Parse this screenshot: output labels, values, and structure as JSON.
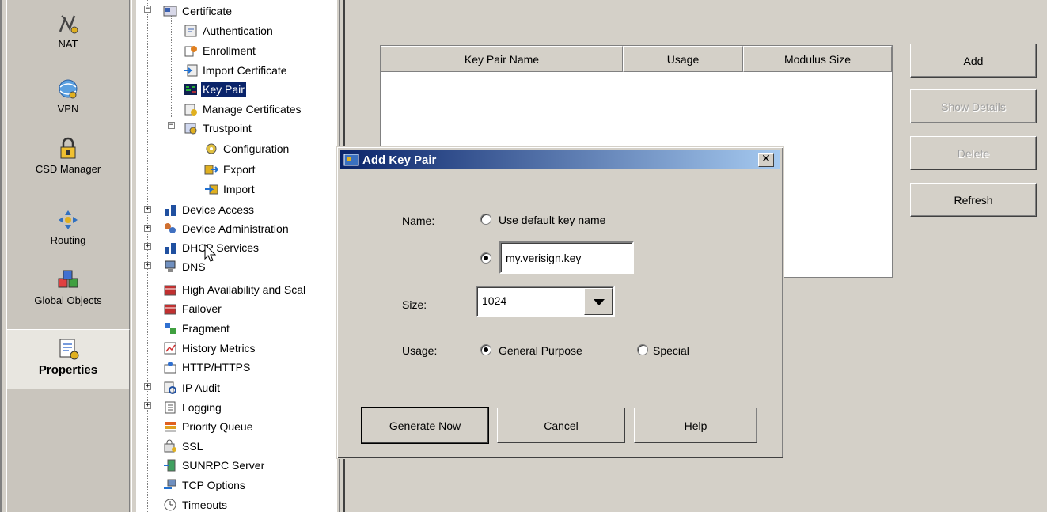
{
  "nav": {
    "items": [
      {
        "label": "NAT",
        "icon": "nat-icon"
      },
      {
        "label": "VPN",
        "icon": "vpn-icon"
      },
      {
        "label": "CSD Manager",
        "icon": "csd-manager-icon"
      },
      {
        "label": "Routing",
        "icon": "routing-icon"
      },
      {
        "label": "Global Objects",
        "icon": "global-objects-icon"
      },
      {
        "label": "Properties",
        "icon": "properties-icon",
        "selected": true
      }
    ]
  },
  "tree": {
    "nodes": [
      {
        "label": "Certificate",
        "icon": "certificate-folder-icon"
      },
      {
        "label": "Authentication",
        "icon": "authentication-icon"
      },
      {
        "label": "Enrollment",
        "icon": "enrollment-icon"
      },
      {
        "label": "Import Certificate",
        "icon": "import-certificate-icon"
      },
      {
        "label": "Key Pair",
        "icon": "key-pair-icon",
        "selected": true
      },
      {
        "label": "Manage Certificates",
        "icon": "manage-certificates-icon"
      },
      {
        "label": "Trustpoint",
        "icon": "trustpoint-icon"
      },
      {
        "label": "Configuration",
        "icon": "configuration-icon"
      },
      {
        "label": "Export",
        "icon": "export-icon"
      },
      {
        "label": "Import",
        "icon": "import-icon"
      },
      {
        "label": "Device Access",
        "icon": "device-access-icon"
      },
      {
        "label": "Device Administration",
        "icon": "device-administration-icon"
      },
      {
        "label": "DHCP Services",
        "icon": "dhcp-services-icon"
      },
      {
        "label": "DNS",
        "icon": "dns-icon"
      },
      {
        "label": "High Availability and Scal",
        "icon": "high-availability-icon"
      },
      {
        "label": "Failover",
        "icon": "failover-icon"
      },
      {
        "label": "Fragment",
        "icon": "fragment-icon"
      },
      {
        "label": "History Metrics",
        "icon": "history-metrics-icon"
      },
      {
        "label": "HTTP/HTTPS",
        "icon": "http-https-icon"
      },
      {
        "label": "IP Audit",
        "icon": "ip-audit-icon"
      },
      {
        "label": "Logging",
        "icon": "logging-icon"
      },
      {
        "label": "Priority Queue",
        "icon": "priority-queue-icon"
      },
      {
        "label": "SSL",
        "icon": "ssl-icon"
      },
      {
        "label": "SUNRPC Server",
        "icon": "sunrpc-server-icon"
      },
      {
        "label": "TCP Options",
        "icon": "tcp-options-icon"
      },
      {
        "label": "Timeouts",
        "icon": "timeouts-icon"
      }
    ]
  },
  "table": {
    "columns": [
      "Key Pair Name",
      "Usage",
      "Modulus Size"
    ],
    "rows": []
  },
  "buttons": {
    "add": "Add",
    "show_details": "Show Details",
    "delete": "Delete",
    "refresh": "Refresh"
  },
  "dialog": {
    "title": "Add Key Pair",
    "close_glyph": "✕",
    "name_label": "Name:",
    "use_default_label": "Use default key name",
    "name_value": "my.verisign.key",
    "name_mode": "custom",
    "size_label": "Size:",
    "size_value": "1024",
    "usage_label": "Usage:",
    "usage_general": "General Purpose",
    "usage_special": "Special",
    "usage_selected": "General Purpose",
    "generate_button": "Generate Now",
    "cancel_button": "Cancel",
    "help_button": "Help"
  },
  "colors": {
    "titlebar_start": "#0a246a",
    "titlebar_end": "#a6caf0",
    "selection": "#0a246a",
    "window_bg": "#d4d0c8"
  }
}
